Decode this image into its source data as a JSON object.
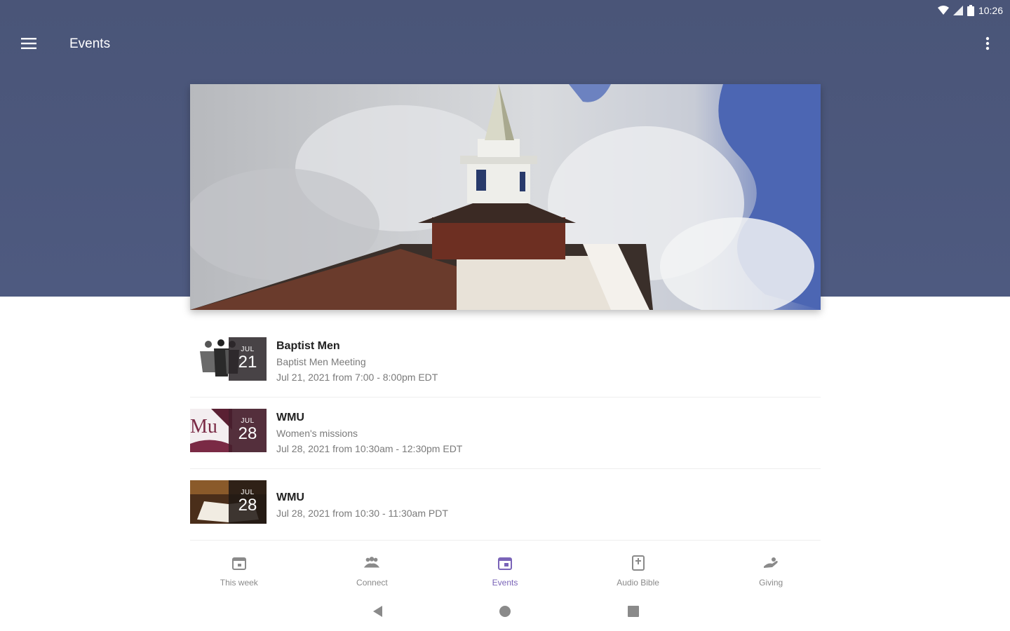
{
  "status_bar": {
    "time": "10:26"
  },
  "app_bar": {
    "title": "Events"
  },
  "events": [
    {
      "title": "Baptist Men",
      "description": "Baptist Men Meeting",
      "when": "Jul 21, 2021 from 7:00 - 8:00pm EDT",
      "month": "JUL",
      "day": "21"
    },
    {
      "title": "WMU",
      "description": "Women's missions",
      "when": "Jul 28, 2021 from 10:30am - 12:30pm EDT",
      "month": "JUL",
      "day": "28",
      "thumb_text": "Mu"
    },
    {
      "title": "WMU",
      "when": "Jul 28, 2021 from 10:30 - 11:30am PDT",
      "month": "JUL",
      "day": "28"
    }
  ],
  "bottom_nav": [
    {
      "label": "This week",
      "icon": "calendar-icon",
      "active": false
    },
    {
      "label": "Connect",
      "icon": "people-icon",
      "active": false
    },
    {
      "label": "Events",
      "icon": "calendar-event-icon",
      "active": true
    },
    {
      "label": "Audio Bible",
      "icon": "bible-icon",
      "active": false
    },
    {
      "label": "Giving",
      "icon": "giving-hand-icon",
      "active": false
    }
  ],
  "colors": {
    "header": "#4a5578",
    "accent": "#7a64b8",
    "text_secondary": "#7a7a7a"
  }
}
